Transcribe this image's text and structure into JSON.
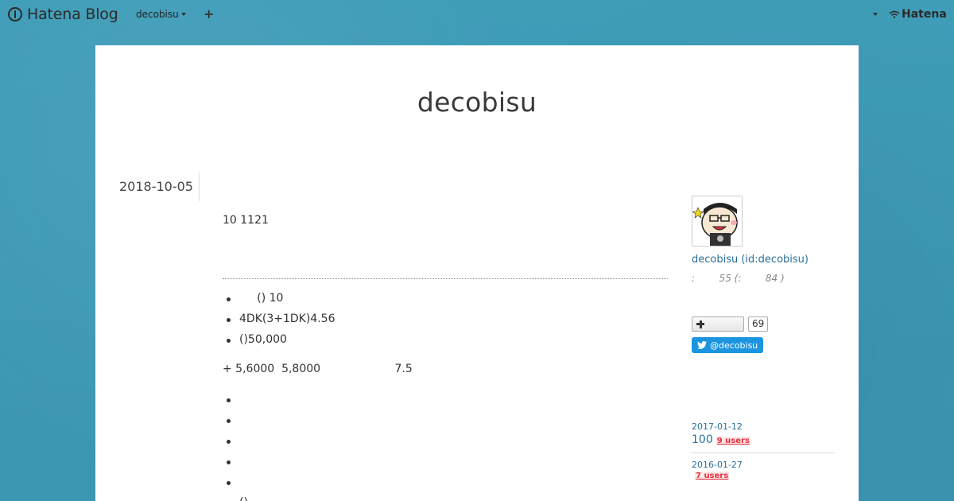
{
  "header": {
    "logo_text": "Hatena Blog",
    "blog_menu_label": "decobisu",
    "plus_label": "+",
    "hatena_label": "Hatena"
  },
  "blog": {
    "title": "decobisu"
  },
  "entry": {
    "date": "2018-10-05",
    "summary": "10  1121",
    "list": [
      "     () 10",
      "4DK(3+1DK)4.56",
      "()50,000"
    ],
    "paragraph": "+ 5,6000  5,8000                     7.5",
    "list2": [
      "",
      "",
      "",
      "",
      "",
      "()"
    ]
  },
  "sidebar": {
    "profile_name": "decobisu (id:decobisu)",
    "profile_stats": ":        55 (:        84 )",
    "bookmark_count": "69",
    "twitter_label": "@decobisu",
    "archive": [
      {
        "date": "2017-01-12",
        "title": "100",
        "users": "9 users"
      },
      {
        "date": "2016-01-27",
        "title": "",
        "users": "7 users"
      }
    ]
  }
}
